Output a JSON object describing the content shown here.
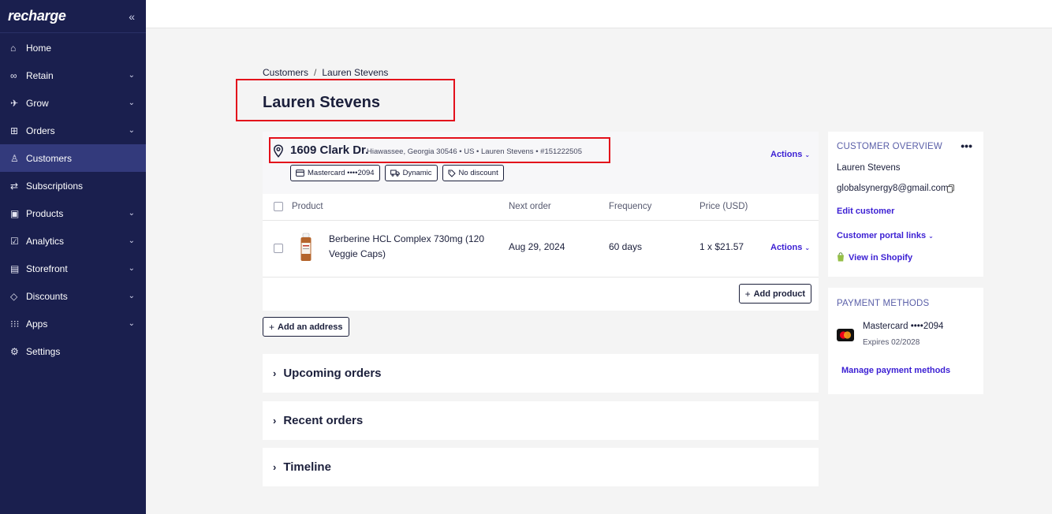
{
  "sidebar": {
    "brand": "recharge",
    "collapse_icon": "«",
    "items": [
      {
        "label": "Home",
        "icon": "home-icon",
        "glyph": "⌂",
        "has_chevron": false
      },
      {
        "label": "Retain",
        "icon": "infinity-icon",
        "glyph": "∞",
        "has_chevron": true
      },
      {
        "label": "Grow",
        "icon": "rocket-icon",
        "glyph": "✈",
        "has_chevron": true
      },
      {
        "label": "Orders",
        "icon": "cart-icon",
        "glyph": "⊞",
        "has_chevron": true
      },
      {
        "label": "Customers",
        "icon": "user-icon",
        "glyph": "♙",
        "has_chevron": false,
        "active": true
      },
      {
        "label": "Subscriptions",
        "icon": "repeat-icon",
        "glyph": "⇄",
        "has_chevron": false
      },
      {
        "label": "Products",
        "icon": "box-icon",
        "glyph": "▣",
        "has_chevron": true
      },
      {
        "label": "Analytics",
        "icon": "chart-icon",
        "glyph": "☑",
        "has_chevron": true
      },
      {
        "label": "Storefront",
        "icon": "store-icon",
        "glyph": "▤",
        "has_chevron": true
      },
      {
        "label": "Discounts",
        "icon": "tag-icon",
        "glyph": "◇",
        "has_chevron": true
      },
      {
        "label": "Apps",
        "icon": "grid-icon",
        "glyph": "⁝⁝⁝",
        "has_chevron": true
      },
      {
        "label": "Settings",
        "icon": "gear-icon",
        "glyph": "⚙",
        "has_chevron": false
      }
    ]
  },
  "breadcrumb": {
    "parent": "Customers",
    "separator": "/",
    "current": "Lauren Stevens"
  },
  "page_title": "Lauren Stevens",
  "address": {
    "street": "1609 Clark Dr.",
    "meta": "Hiawassee, Georgia 30546  •  US  •  Lauren Stevens  •  #151222505",
    "actions": "Actions",
    "chips": {
      "card": "Mastercard ••••2094",
      "shipping": "Dynamic",
      "discount": "No discount"
    }
  },
  "table": {
    "headers": {
      "product": "Product",
      "next_order": "Next order",
      "frequency": "Frequency",
      "price": "Price (USD)"
    },
    "row": {
      "product_line1": "Berberine HCL Complex 730mg (120",
      "product_line2": "Veggie Caps)",
      "next_order": "Aug 29, 2024",
      "frequency": "60 days",
      "price": "1 x $21.57",
      "actions": "Actions"
    },
    "add_product": "Add product"
  },
  "add_address": "Add an address",
  "sections": {
    "upcoming": "Upcoming orders",
    "recent": "Recent orders",
    "timeline": "Timeline"
  },
  "overview": {
    "heading": "CUSTOMER OVERVIEW",
    "more": "•••",
    "name": "Lauren Stevens",
    "email": "globalsynergy8@gmail.com",
    "edit": "Edit customer",
    "portal": "Customer portal links",
    "shopify": "View in Shopify"
  },
  "payment": {
    "heading": "PAYMENT METHODS",
    "card": "Mastercard ••••2094",
    "expires": "Expires 02/2028",
    "manage": "Manage payment methods"
  },
  "colors": {
    "sidebar": "#1a1f4e",
    "active": "#333a7c",
    "link": "#3b1fd3",
    "highlight": "#e3101b",
    "heading": "#5a5fa8"
  }
}
